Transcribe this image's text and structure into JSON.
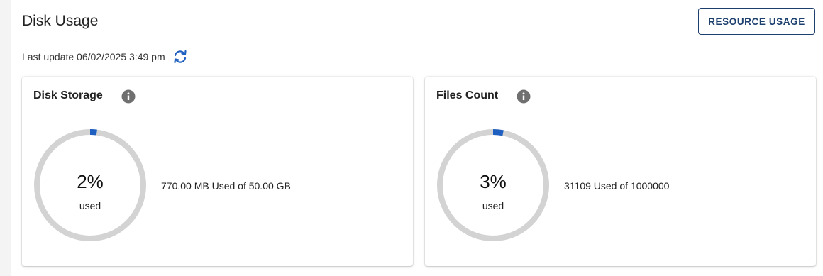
{
  "header": {
    "title": "Disk Usage",
    "resource_button": "RESOURCE USAGE",
    "last_update": "Last update 06/02/2025 3:49 pm",
    "refresh_icon": "refresh-icon"
  },
  "colors": {
    "accent": "#1f5fbf",
    "track": "#d3d3d3",
    "button_border": "#1c3f6e",
    "info_icon": "#707070"
  },
  "cards": [
    {
      "title": "Disk Storage",
      "info_icon": "info-icon",
      "percent": 2,
      "percent_label": "2%",
      "used_label": "used",
      "usage_text": "770.00 MB Used of 50.00 GB"
    },
    {
      "title": "Files Count",
      "info_icon": "info-icon",
      "percent": 3,
      "percent_label": "3%",
      "used_label": "used",
      "usage_text": "31109 Used of 1000000"
    }
  ]
}
